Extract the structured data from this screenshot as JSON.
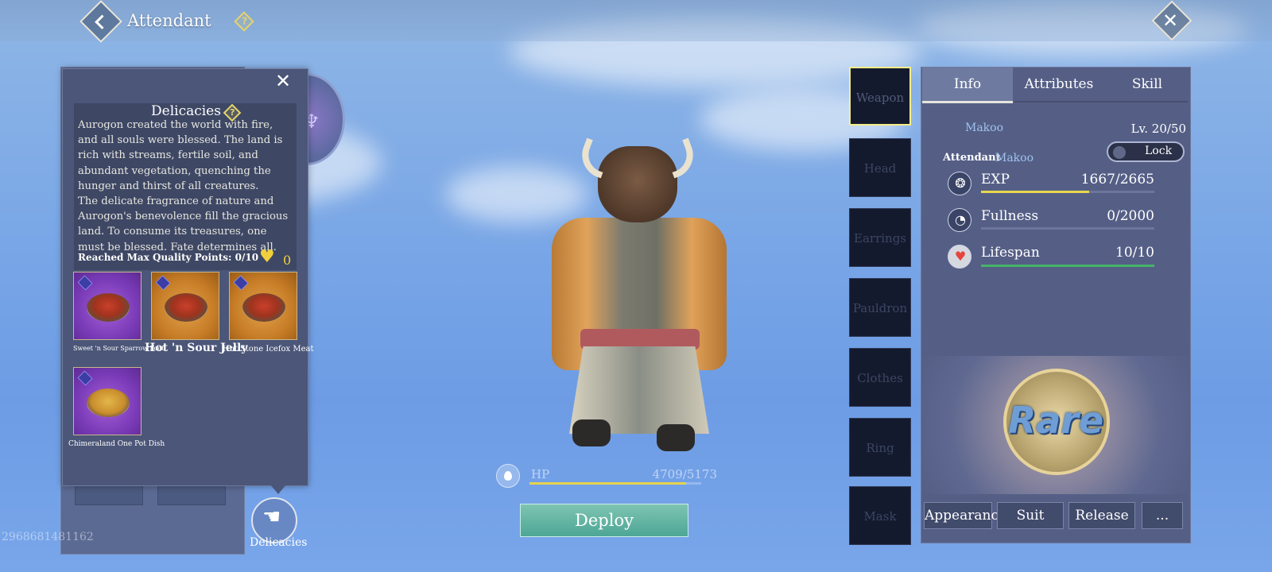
{
  "header": {
    "title": "Attendant"
  },
  "left_panel": {
    "id_text": "2968681481162"
  },
  "popup": {
    "title": "Delicacies",
    "description": "Aurogon created the world with fire, and all souls were blessed. The land is rich with streams, fertile soil, and abundant vegetation, quenching the hunger and thirst of all creatures.\nThe delicate fragrance of nature and Aurogon's benevolence fill the gracious land. To consume its treasures, one must be blessed. Fate determines all.",
    "max_quality": "Reached Max Quality Points: 0/10",
    "hearts": "0",
    "items": [
      {
        "label": "Sweet 'n Sour Sparrow Foot"
      },
      {
        "label": "Hot 'n Sour Jelly"
      },
      {
        "label": "Hot Stone Icefox Meat"
      },
      {
        "label": "Chimeraland One Pot Dish"
      }
    ]
  },
  "delicacies_button": {
    "label": "Delicacies"
  },
  "character": {
    "hp_label": "HP",
    "hp_value": "4709/5173",
    "hp_fraction": 0.91
  },
  "deploy_label": "Deploy",
  "equipment_slots": [
    "Weapon",
    "Head",
    "Earrings",
    "Pauldron",
    "Clothes",
    "Ring",
    "Mask"
  ],
  "right_panel": {
    "tabs": [
      "Info",
      "Attributes",
      "Skill"
    ],
    "name": "Makoo",
    "level": "Lv. 20/50",
    "attendant_prefix": "Attendant",
    "attendant_name": "Makoo",
    "lock_label": "Lock",
    "stats": [
      {
        "label": "EXP",
        "value": "1667/2665",
        "fraction": 0.626,
        "color": "#e8d64d",
        "icon": "exp-icon"
      },
      {
        "label": "Fullness",
        "value": "0/2000",
        "fraction": 0,
        "color": "#e8d64d",
        "icon": "stomach-icon"
      },
      {
        "label": "Lifespan",
        "value": "10/10",
        "fraction": 1,
        "color": "#46b36a",
        "icon": "heart-icon"
      }
    ],
    "rarity": "Rare",
    "actions": [
      "Appearance",
      "Suit",
      "Release",
      "..."
    ]
  }
}
